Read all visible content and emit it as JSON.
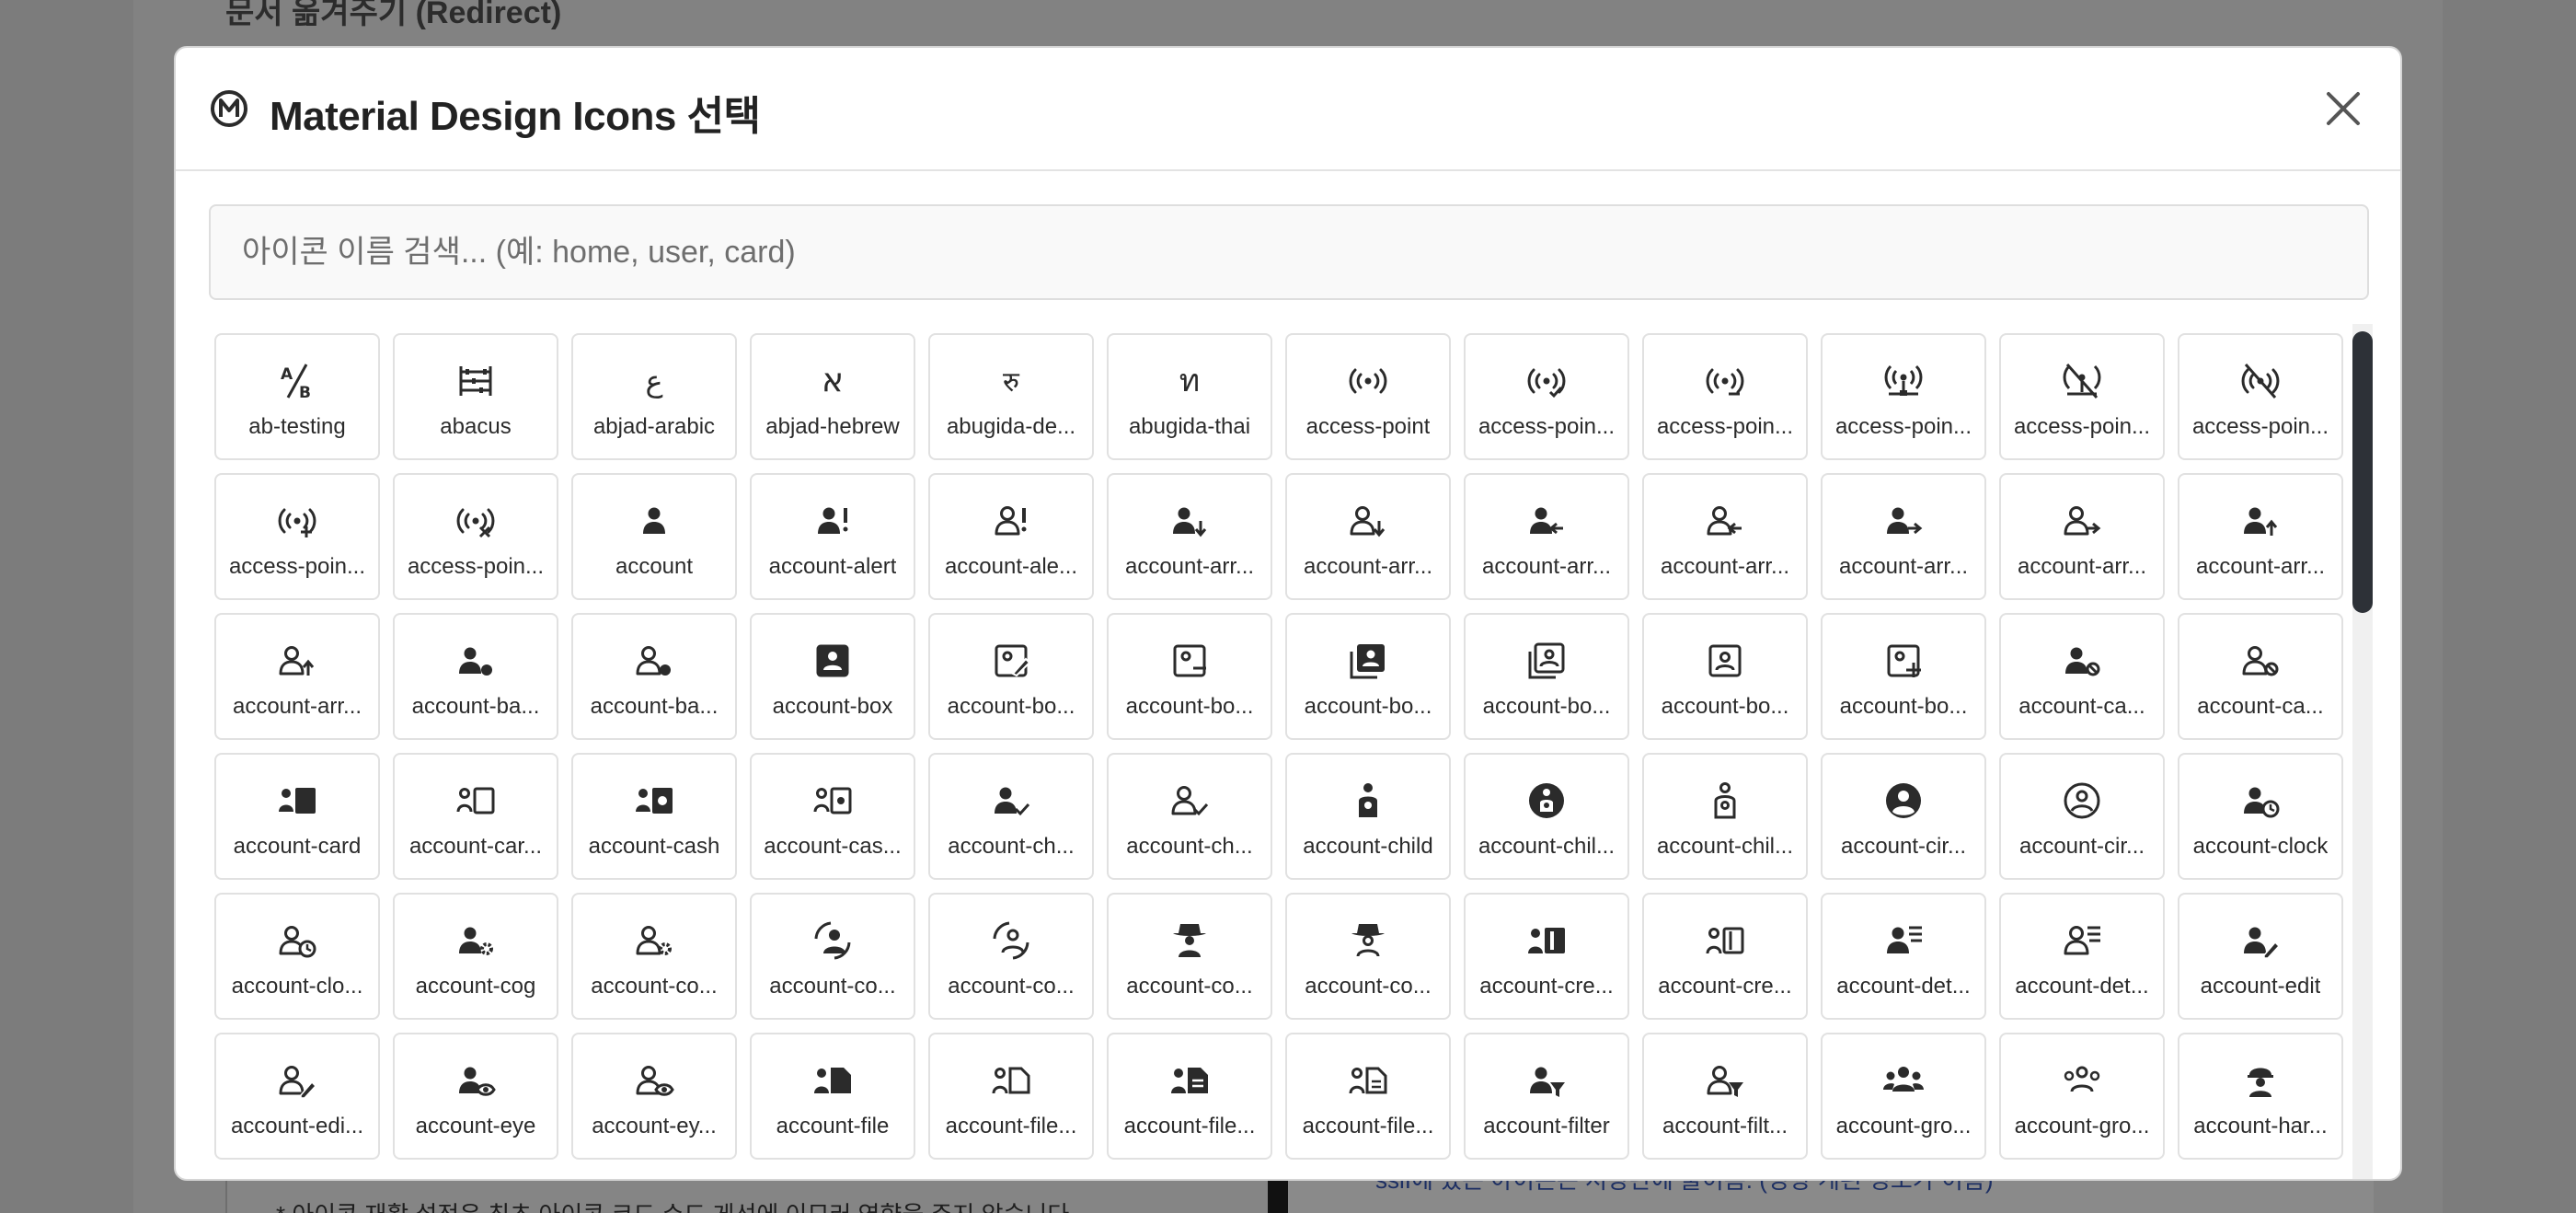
{
  "background": {
    "heading": "문서 옮겨주기 (Redirect)",
    "left_note": "* 아이콘 재활 설정은 최초 아이콘 코드 수드 게선에 이묘러 영향을 주지 않습니다",
    "right_note": "sslI에 있는 아이콘은 저장관에 불이름. (영향 게된 정보가 이름)"
  },
  "modal": {
    "title": "Material Design Icons 선택",
    "close_icon": "close-icon",
    "search": {
      "placeholder": "아이콘 이름 검색... (예: home, user, card)",
      "value": ""
    }
  },
  "icons": [
    {
      "label": "ab-testing",
      "icon": "ab-testing"
    },
    {
      "label": "abacus",
      "icon": "abacus"
    },
    {
      "label": "abjad-arabic",
      "icon": "abjad-arabic"
    },
    {
      "label": "abjad-hebrew",
      "icon": "abjad-hebrew"
    },
    {
      "label": "abugida-de...",
      "icon": "abugida-devanagari"
    },
    {
      "label": "abugida-thai",
      "icon": "abugida-thai"
    },
    {
      "label": "access-point",
      "icon": "access-point"
    },
    {
      "label": "access-poin...",
      "icon": "access-point-check"
    },
    {
      "label": "access-poin...",
      "icon": "access-point-minus"
    },
    {
      "label": "access-poin...",
      "icon": "access-point-network"
    },
    {
      "label": "access-poin...",
      "icon": "access-point-network-off"
    },
    {
      "label": "access-poin...",
      "icon": "access-point-off"
    },
    {
      "label": "access-poin...",
      "icon": "access-point-plus"
    },
    {
      "label": "access-poin...",
      "icon": "access-point-remove"
    },
    {
      "label": "account",
      "icon": "account"
    },
    {
      "label": "account-alert",
      "icon": "account-alert"
    },
    {
      "label": "account-ale...",
      "icon": "account-alert-outline"
    },
    {
      "label": "account-arr...",
      "icon": "account-arrow-down"
    },
    {
      "label": "account-arr...",
      "icon": "account-arrow-down-outline"
    },
    {
      "label": "account-arr...",
      "icon": "account-arrow-left"
    },
    {
      "label": "account-arr...",
      "icon": "account-arrow-left-outline"
    },
    {
      "label": "account-arr...",
      "icon": "account-arrow-right"
    },
    {
      "label": "account-arr...",
      "icon": "account-arrow-right-outline"
    },
    {
      "label": "account-arr...",
      "icon": "account-arrow-up"
    },
    {
      "label": "account-arr...",
      "icon": "account-arrow-up-outline"
    },
    {
      "label": "account-ba...",
      "icon": "account-badge"
    },
    {
      "label": "account-ba...",
      "icon": "account-badge-outline"
    },
    {
      "label": "account-box",
      "icon": "account-box"
    },
    {
      "label": "account-bo...",
      "icon": "account-box-edit-outline"
    },
    {
      "label": "account-bo...",
      "icon": "account-box-minus-outline"
    },
    {
      "label": "account-bo...",
      "icon": "account-box-multiple"
    },
    {
      "label": "account-bo...",
      "icon": "account-box-multiple-outline"
    },
    {
      "label": "account-bo...",
      "icon": "account-box-outline"
    },
    {
      "label": "account-bo...",
      "icon": "account-box-plus-outline"
    },
    {
      "label": "account-ca...",
      "icon": "account-cancel"
    },
    {
      "label": "account-ca...",
      "icon": "account-cancel-outline"
    },
    {
      "label": "account-card",
      "icon": "account-card"
    },
    {
      "label": "account-car...",
      "icon": "account-card-outline"
    },
    {
      "label": "account-cash",
      "icon": "account-cash"
    },
    {
      "label": "account-cas...",
      "icon": "account-cash-outline"
    },
    {
      "label": "account-ch...",
      "icon": "account-check"
    },
    {
      "label": "account-ch...",
      "icon": "account-check-outline"
    },
    {
      "label": "account-child",
      "icon": "account-child"
    },
    {
      "label": "account-chil...",
      "icon": "account-child-circle"
    },
    {
      "label": "account-chil...",
      "icon": "account-child-outline"
    },
    {
      "label": "account-cir...",
      "icon": "account-circle"
    },
    {
      "label": "account-cir...",
      "icon": "account-circle-outline"
    },
    {
      "label": "account-clock",
      "icon": "account-clock"
    },
    {
      "label": "account-clo...",
      "icon": "account-clock-outline"
    },
    {
      "label": "account-cog",
      "icon": "account-cog"
    },
    {
      "label": "account-co...",
      "icon": "account-cog-outline"
    },
    {
      "label": "account-co...",
      "icon": "account-convert"
    },
    {
      "label": "account-co...",
      "icon": "account-convert-outline"
    },
    {
      "label": "account-co...",
      "icon": "account-cowboy-hat"
    },
    {
      "label": "account-co...",
      "icon": "account-cowboy-hat-outline"
    },
    {
      "label": "account-cre...",
      "icon": "account-credit-card"
    },
    {
      "label": "account-cre...",
      "icon": "account-credit-card-outline"
    },
    {
      "label": "account-det...",
      "icon": "account-details"
    },
    {
      "label": "account-det...",
      "icon": "account-details-outline"
    },
    {
      "label": "account-edit",
      "icon": "account-edit"
    },
    {
      "label": "account-edi...",
      "icon": "account-edit-outline"
    },
    {
      "label": "account-eye",
      "icon": "account-eye"
    },
    {
      "label": "account-ey...",
      "icon": "account-eye-outline"
    },
    {
      "label": "account-file",
      "icon": "account-file"
    },
    {
      "label": "account-file...",
      "icon": "account-file-outline"
    },
    {
      "label": "account-file...",
      "icon": "account-file-text"
    },
    {
      "label": "account-file...",
      "icon": "account-file-text-outline"
    },
    {
      "label": "account-filter",
      "icon": "account-filter"
    },
    {
      "label": "account-filt...",
      "icon": "account-filter-outline"
    },
    {
      "label": "account-gro...",
      "icon": "account-group"
    },
    {
      "label": "account-gro...",
      "icon": "account-group-outline"
    },
    {
      "label": "account-har...",
      "icon": "account-hard-hat"
    }
  ],
  "colors": {
    "icon_color": "#2b2b2b",
    "overlay": "#7c7c7c",
    "scrollbar_thumb": "#2d3137"
  }
}
